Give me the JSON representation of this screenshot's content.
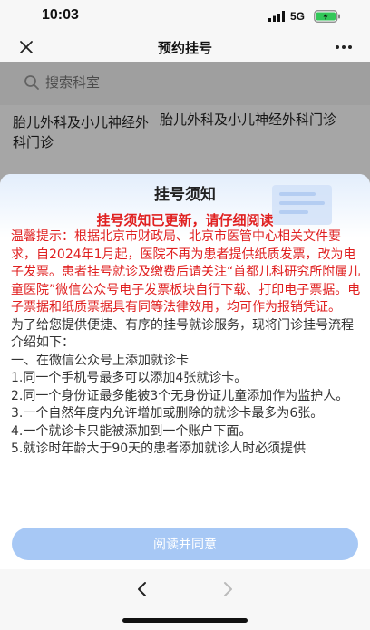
{
  "status": {
    "time": "10:03",
    "network": "5G"
  },
  "nav": {
    "title": "预约挂号",
    "close_icon": "close-icon",
    "more_icon": "more-icon"
  },
  "page": {
    "search_placeholder": "搜索科室",
    "dept_left": "胎儿外科及小儿神经外科门诊",
    "dept_right": "胎儿外科及小儿神经外科门诊"
  },
  "modal": {
    "title": "挂号须知",
    "notice": "挂号须知已更新，请仔细阅读",
    "red_paragraph": "温馨提示：根据北京市财政局、北京市医管中心相关文件要求，自2024年1月起，医院不再为患者提供纸质发票，改为电子发票。患者挂号就诊及缴费后请关注“首都儿科研究所附属儿童医院”微信公众号电子发票板块自行下载、打印电子票据。电子票据和纸质票据具有同等法律效用，均可作为报销凭证。",
    "intro": "为了给您提供便捷、有序的挂号就诊服务，现将门诊挂号流程介绍如下：",
    "section1": "一、在微信公众号上添加就诊卡",
    "item1": "1.同一个手机号最多可以添加4张就诊卡。",
    "item2": "2.同一个身份证最多能被3个无身份证儿童添加作为监护人。",
    "item3": "3.一个自然年度内允许增加或删除的就诊卡最多为6张。",
    "item4": "4.一个就诊卡只能被添加到一个账户下面。",
    "item5": "5.就诊时年龄大于90天的患者添加就诊人时必须提供",
    "agree_button": "阅读并同意"
  },
  "colors": {
    "accent_red": "#e02020",
    "button_blue": "#a7c8f5"
  }
}
